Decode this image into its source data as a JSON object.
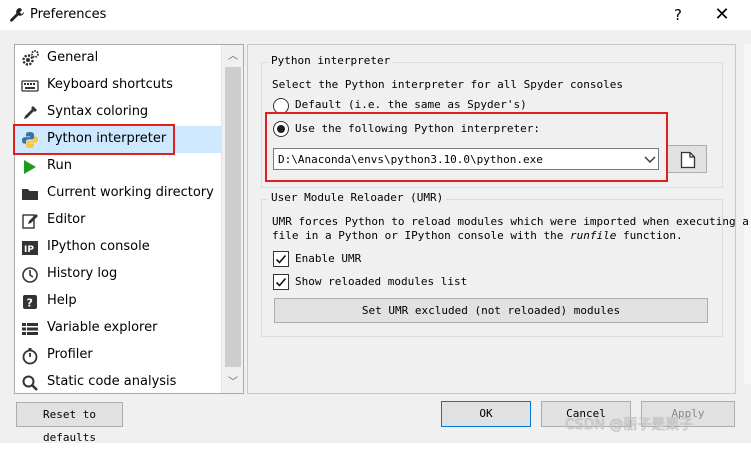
{
  "window": {
    "title": "Preferences",
    "help_glyph": "?",
    "close_glyph": "✕"
  },
  "sidebar": {
    "items": [
      {
        "label": "General",
        "icon": "gear-icon"
      },
      {
        "label": "Keyboard shortcuts",
        "icon": "keyboard-icon"
      },
      {
        "label": "Syntax coloring",
        "icon": "eyedropper-icon"
      },
      {
        "label": "Python interpreter",
        "icon": "python-icon",
        "selected": true
      },
      {
        "label": "Run",
        "icon": "play-icon"
      },
      {
        "label": "Current working directory",
        "icon": "folder-icon"
      },
      {
        "label": "Editor",
        "icon": "edit-icon"
      },
      {
        "label": "IPython console",
        "icon": "ipython-icon"
      },
      {
        "label": "History log",
        "icon": "history-icon"
      },
      {
        "label": "Help",
        "icon": "help-icon"
      },
      {
        "label": "Variable explorer",
        "icon": "table-icon"
      },
      {
        "label": "Profiler",
        "icon": "stopwatch-icon"
      },
      {
        "label": "Static code analysis",
        "icon": "magnifier-icon"
      }
    ],
    "scroll_up_glyph": "︿",
    "scroll_down_glyph": "﹀"
  },
  "python_interpreter": {
    "group_title": "Python interpreter",
    "description": "Select the Python interpreter for all Spyder consoles",
    "default_option": "Default (i.e. the same as Spyder's)",
    "custom_option": "Use the following Python interpreter:",
    "selected_option": "custom",
    "interpreter_path": "D:\\Anaconda\\envs\\python3.10.0\\python.exe"
  },
  "umr": {
    "group_title": "User Module Reloader (UMR)",
    "description_line1": "UMR forces Python to reload modules which were imported when executing a",
    "description_line2_prefix": "file in a Python or IPython console with the ",
    "description_line2_italic": "runfile",
    "description_line2_suffix": " function.",
    "enable_label": "Enable UMR",
    "enable_checked": true,
    "show_list_label": "Show reloaded modules list",
    "show_list_checked": true,
    "excluded_button": "Set UMR excluded (not reloaded) modules"
  },
  "footer": {
    "reset_button": "Reset to defaults",
    "ok_button": "OK",
    "cancel_button": "Cancel",
    "apply_button": "Apply"
  },
  "watermark": "CSDN @丽子是栗子",
  "colors": {
    "highlight_red": "#e11f1f",
    "selection_blue": "#cde8ff"
  }
}
